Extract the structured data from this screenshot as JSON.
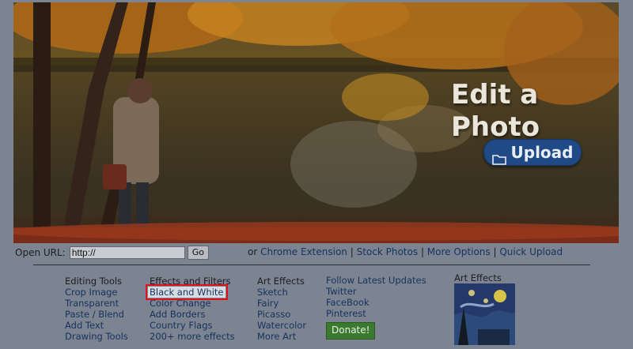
{
  "hero": {
    "title": "Edit a Photo",
    "upload_label": "Upload"
  },
  "urlbar": {
    "label": "Open URL:",
    "value": "http://",
    "go_label": "Go"
  },
  "links": {
    "prefix": "or",
    "items": [
      "Chrome Extension",
      "Stock Photos",
      "More Options",
      "Quick Upload"
    ],
    "separator": " | "
  },
  "columns": {
    "editing": {
      "heading": "Editing Tools",
      "items": [
        "Crop Image",
        "Transparent",
        "Paste / Blend",
        "Add Text",
        "Drawing Tools"
      ]
    },
    "effects": {
      "heading": "Effects and Filters",
      "items": [
        "Black and White",
        "Color Change",
        "Add Borders",
        "Country Flags",
        "200+ more effects"
      ]
    },
    "art": {
      "heading": "Art Effects",
      "items": [
        "Sketch",
        "Fairy",
        "Picasso",
        "Watercolor",
        "More Art"
      ]
    },
    "follow": {
      "heading": "Follow Latest Updates",
      "items": [
        "Twitter",
        "FaceBook",
        "Pinterest"
      ],
      "donate_label": "Donate!"
    },
    "art_thumb": {
      "heading": "Art Effects"
    }
  },
  "colors": {
    "upload_button": "#1f4a86",
    "link": "#17325e",
    "highlight_border": "#e0121a",
    "donate": "#3a7a2e"
  }
}
